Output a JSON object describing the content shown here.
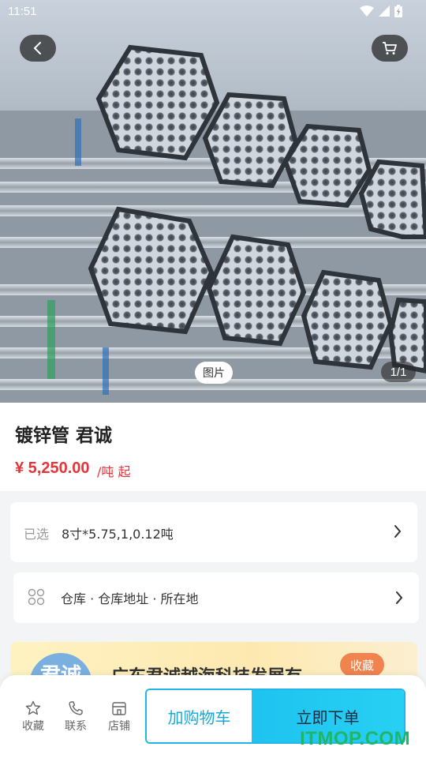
{
  "status_bar": {
    "time": "11:51"
  },
  "hero": {
    "image_label": "图片",
    "image_counter": "1/1"
  },
  "product": {
    "title": "镀锌管 君诚",
    "price": "¥ 5,250.00",
    "price_unit": "/吨 起"
  },
  "selection": {
    "label": "已选",
    "value": "8寸*5.75,1,0.12吨"
  },
  "warehouse": {
    "text": "仓库 · 仓库地址 · 所在地"
  },
  "shop": {
    "logo_text": "君诚",
    "name": "广东君诚越海科技发展有",
    "favorite_label": "收藏"
  },
  "bottom_bar": {
    "favorite_label": "收藏",
    "contact_label": "联系",
    "shop_label": "店铺",
    "add_to_cart_label": "加购物车",
    "buy_now_label": "立即下单"
  },
  "watermark": "ITMOP.COM",
  "colors": {
    "price_red": "#e8333a",
    "accent_cyan": "#1fb7e6",
    "favorite_orange": "#f1834e",
    "watermark_green": "#1fb56b"
  }
}
